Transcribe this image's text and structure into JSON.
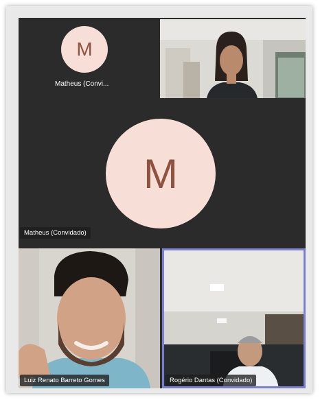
{
  "participants": {
    "top_left": {
      "initial": "M",
      "name": "Matheus (Convi..."
    },
    "top_right": {
      "name": ""
    },
    "center": {
      "initial": "M",
      "name": "Matheus (Convidado)"
    },
    "bottom_left": {
      "name": "Luiz Renato Barreto Gomes"
    },
    "bottom_right": {
      "name": "Rogério Dantas (Convidado)"
    }
  },
  "colors": {
    "stage_background": "#2b2b2b",
    "avatar_background": "#f7dfd7",
    "avatar_letter": "#8e5241",
    "active_speaker_border": "#7b7fd4"
  },
  "icons": {
    "avatar_top_left": "avatar-initial-M",
    "avatar_center": "avatar-initial-M"
  }
}
